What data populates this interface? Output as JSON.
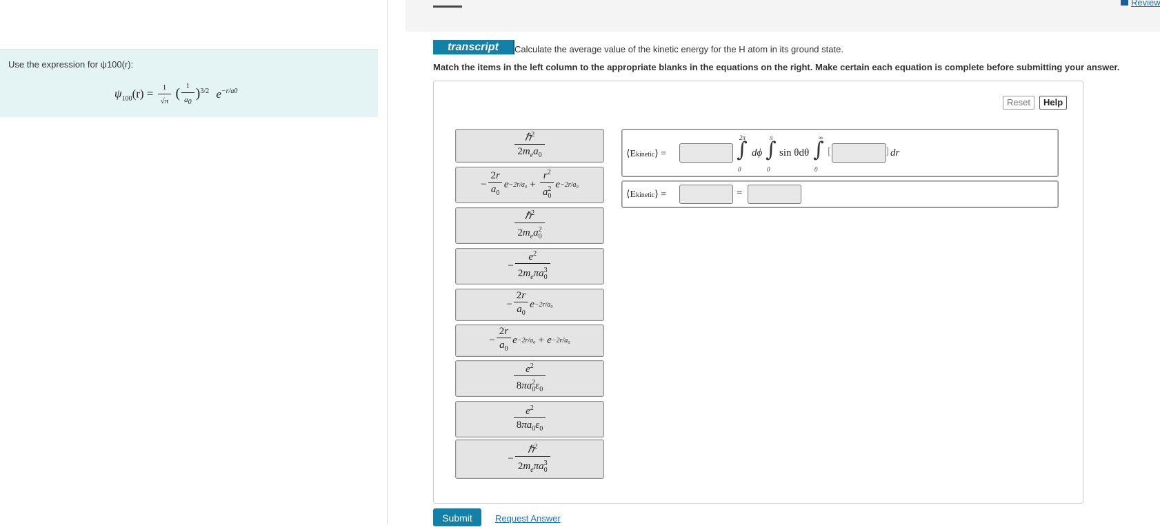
{
  "hint": {
    "intro": "Use the expression for ψ100(r):",
    "formula_lhs": "ψ",
    "formula_sub": "100",
    "formula_arg": "(r) = ",
    "formula_rhs_a": "1/√π",
    "formula_rhs_b": "(1/a0)",
    "formula_power": "3/2",
    "formula_exp": "e",
    "formula_exp_power": "−r/a0"
  },
  "header": {
    "review_label": "Review"
  },
  "transcript": {
    "badge": "transcript",
    "question": "Calculate the average value of the kinetic energy for the H atom in its ground state.",
    "instructions": "Match the items in the left column to the appropriate blanks in the equations on the right. Make certain each equation is complete before submitting your answer."
  },
  "controls": {
    "reset": "Reset",
    "help": "Help",
    "submit": "Submit",
    "request_answer": "Request Answer"
  },
  "tiles": [
    {
      "id": "t1",
      "num": "ℏ²",
      "den": "2mₑa₀",
      "prefix": ""
    },
    {
      "id": "t2",
      "text": "−(2r/a₀)e^(−2r/a₀) + (r²/a₀²)e^(−2r/a₀)"
    },
    {
      "id": "t3",
      "num": "ℏ²",
      "den": "2mₑa₀²",
      "prefix": ""
    },
    {
      "id": "t4",
      "num": "e²",
      "den": "2mₑπa₀³",
      "prefix": "−"
    },
    {
      "id": "t5",
      "text": "−(2r/a₀)e^(−2r/a₀)"
    },
    {
      "id": "t6",
      "text": "−(2r/a₀)e^(−2r/a₀) + e^(−2r/a₀)"
    },
    {
      "id": "t7",
      "num": "e²",
      "den": "8πa₀²ε₀",
      "prefix": ""
    },
    {
      "id": "t8",
      "num": "e²",
      "den": "8πa₀ε₀",
      "prefix": ""
    },
    {
      "id": "t9",
      "num": "ℏ²",
      "den": "2mₑπa₀³",
      "prefix": "−"
    }
  ],
  "equations": {
    "lhs": "⟨E",
    "lhs_sub": "kinetic",
    "lhs_close": "⟩ =",
    "eq_sign": "=",
    "d_phi": "dϕ",
    "sin_term": "sin θdθ",
    "bracket_open": "[",
    "bracket_close": "]",
    "dr": "dr",
    "lim_phi_upper": "2π",
    "lim_theta_upper": "π",
    "lim_r_upper": "∞",
    "lim_lower": "0"
  }
}
